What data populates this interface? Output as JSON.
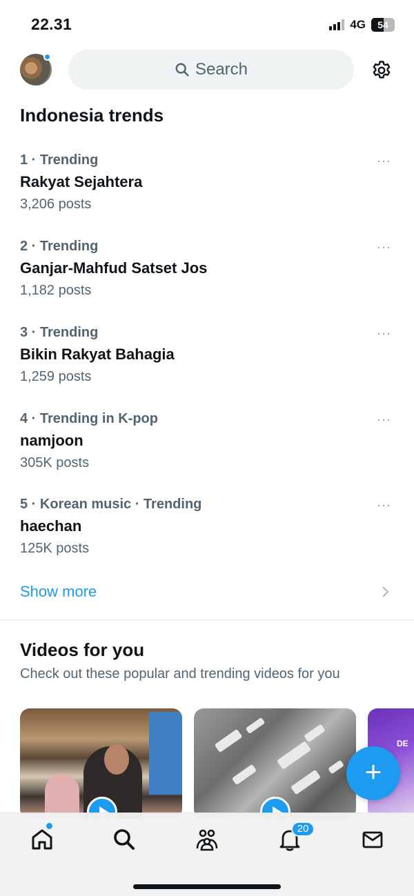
{
  "status_bar": {
    "time": "22.31",
    "network": "4G",
    "battery": "54",
    "battery_level": 0.54
  },
  "header": {
    "search_placeholder": "Search",
    "icons": {
      "search": "search-icon",
      "settings": "gear-icon"
    }
  },
  "trends": {
    "title": "Indonesia trends",
    "items": [
      {
        "meta": "1 · Trending",
        "name": "Rakyat Sejahtera",
        "count": "3,206 posts"
      },
      {
        "meta": "2 · Trending",
        "name": "Ganjar-Mahfud Satset Jos",
        "count": "1,182 posts"
      },
      {
        "meta": "3 · Trending",
        "name": "Bikin Rakyat Bahagia",
        "count": "1,259 posts"
      },
      {
        "meta": "4 · Trending in K-pop",
        "name": "namjoon",
        "count": "305K posts"
      },
      {
        "meta": "5 · Korean music · Trending",
        "name": "haechan",
        "count": "125K posts"
      }
    ],
    "more_icon": "···",
    "show_more": "Show more"
  },
  "videos": {
    "title": "Videos for you",
    "subtitle": "Check out these popular and trending videos for you",
    "card3_partial_text": "DE"
  },
  "fab": {
    "label": "+"
  },
  "bottom_nav": {
    "items": [
      "home-icon",
      "search-icon",
      "communities-icon",
      "notifications-icon",
      "messages-icon"
    ],
    "notification_count": "20"
  },
  "colors": {
    "accent": "#1d9bf0",
    "text_primary": "#0f1419",
    "text_secondary": "#536471",
    "search_bg": "#eff3f4"
  }
}
